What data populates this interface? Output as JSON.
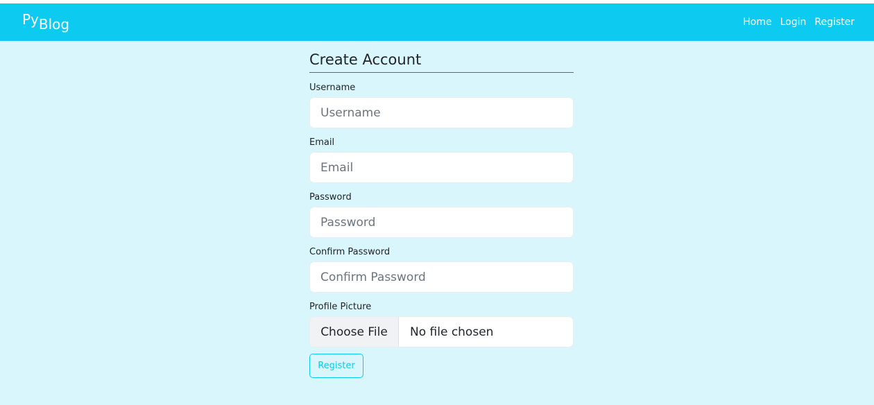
{
  "navbar": {
    "brand_main": "Py",
    "brand_sub": "Blog",
    "links": [
      "Home",
      "Login",
      "Register"
    ]
  },
  "form": {
    "title": "Create Account",
    "username": {
      "label": "Username",
      "placeholder": "Username"
    },
    "email": {
      "label": "Email",
      "placeholder": "Email"
    },
    "password": {
      "label": "Password",
      "placeholder": "Password"
    },
    "confirm_password": {
      "label": "Confirm Password",
      "placeholder": "Confirm Password"
    },
    "profile_picture": {
      "label": "Profile Picture",
      "button": "Choose File",
      "status": "No file chosen"
    },
    "submit": "Register"
  },
  "colors": {
    "navbar": "#0dcaf0",
    "background": "#d8f6fb",
    "accent": "#0dcaf0"
  }
}
